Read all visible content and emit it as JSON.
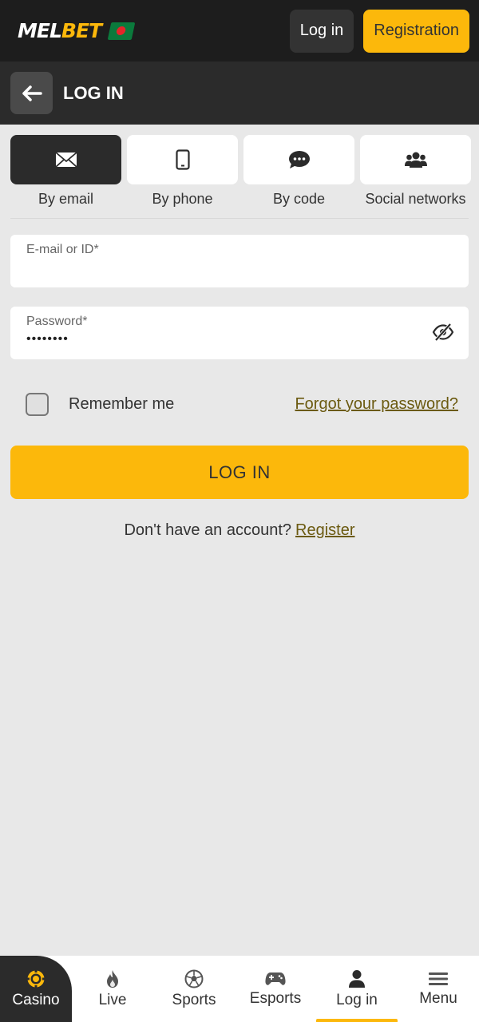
{
  "header": {
    "logo_white": "MEL",
    "logo_yellow": "BET",
    "login_label": "Log in",
    "registration_label": "Registration"
  },
  "page": {
    "title": "LOG IN"
  },
  "tabs": [
    {
      "label": "By email",
      "icon": "envelope-icon",
      "active": true
    },
    {
      "label": "By phone",
      "icon": "phone-icon",
      "active": false
    },
    {
      "label": "By code",
      "icon": "chat-icon",
      "active": false
    },
    {
      "label": "Social networks",
      "icon": "users-icon",
      "active": false
    }
  ],
  "form": {
    "email_label": "E-mail or ID*",
    "email_value": "",
    "password_label": "Password*",
    "password_value": "••••••••",
    "remember_label": "Remember me",
    "remember_checked": false,
    "forgot_label": "Forgot your password?",
    "submit_label": "LOG IN",
    "no_account_text": "Don't have an account?",
    "register_label": "Register"
  },
  "bottom_nav": [
    {
      "label": "Casino",
      "icon": "casino-chip-icon"
    },
    {
      "label": "Live",
      "icon": "flame-icon"
    },
    {
      "label": "Sports",
      "icon": "soccer-ball-icon"
    },
    {
      "label": "Esports",
      "icon": "gamepad-icon"
    },
    {
      "label": "Log in",
      "icon": "user-icon",
      "active": true
    },
    {
      "label": "Menu",
      "icon": "hamburger-icon"
    }
  ],
  "colors": {
    "accent": "#fcb80b",
    "dark": "#1d1d1d",
    "background": "#e8e8e8",
    "link": "#6b5a10"
  }
}
